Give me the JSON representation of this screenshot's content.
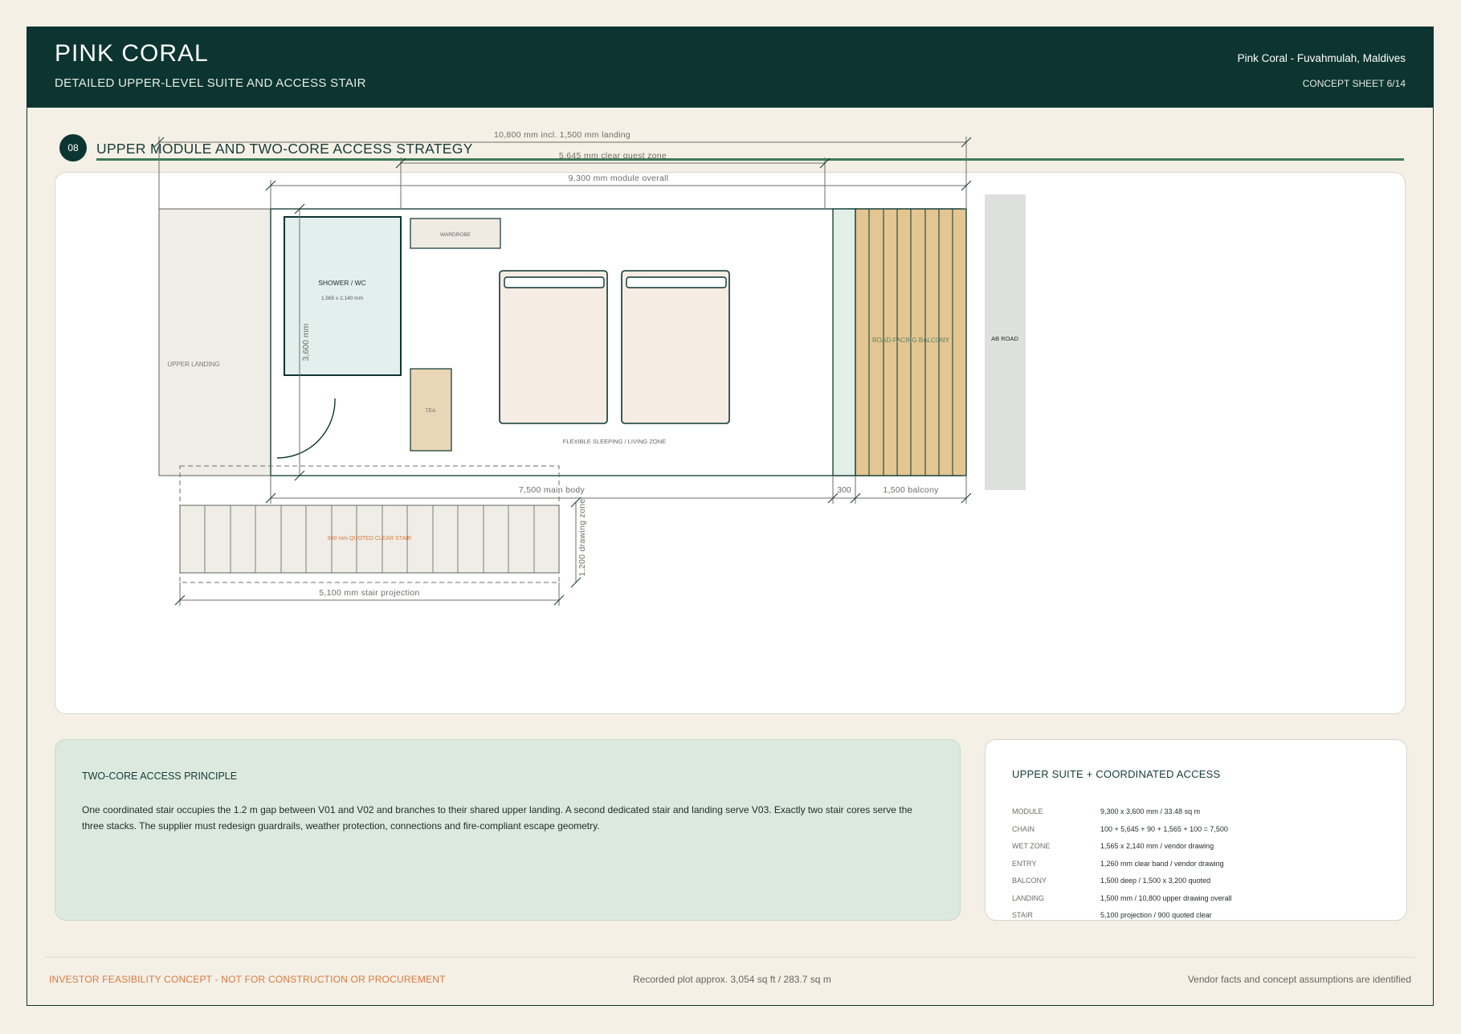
{
  "header": {
    "brand": "PINK CORAL",
    "subtitle": "DETAILED UPPER-LEVEL SUITE AND ACCESS STAIR",
    "location": "Pink Coral - Fuvahmulah, Maldives",
    "sheet": "CONCEPT SHEET 6/14"
  },
  "section": {
    "number": "08",
    "title": "UPPER MODULE AND TWO-CORE ACCESS STRATEGY"
  },
  "plan": {
    "dims": {
      "overall_with_landing": "10,800 mm incl. 1,500 mm landing",
      "clear_guest_zone": "5,645 mm clear guest zone",
      "module_overall": "9,300 mm module overall",
      "module_width": "3,600 mm",
      "main_body": "7,500 main body",
      "gap": "300",
      "balcony": "1,500 balcony",
      "drawing_zone": "1,200 drawing zone",
      "stair_projection": "5,100 mm stair projection"
    },
    "rooms": {
      "upper_landing": "UPPER LANDING",
      "shower_wc": "SHOWER / WC",
      "shower_size": "1,565 x 2,140 mm",
      "wardrobe": "WARDROBE",
      "tea": "TEA",
      "sleeping_zone": "FLEXIBLE SLEEPING / LIVING ZONE",
      "balcony": "ROAD-FACING BALCONY",
      "road": "AB ROAD",
      "stair": "900 mm QUOTED CLEAR STAIR"
    },
    "colors": {
      "ink": "#0c3531",
      "wet_zone": "#e2efec",
      "landing": "#efede6",
      "bed": "#f5ece3",
      "tea": "#e9d6b7",
      "balcony_deck": "#e3c691",
      "road": "#dde0dc",
      "accent_orange": "#d77a3e",
      "accent_green": "#3f7a55"
    }
  },
  "principle": {
    "title": "TWO-CORE ACCESS PRINCIPLE",
    "body": "One coordinated stair occupies the 1.2 m gap between V01 and V02 and branches to their shared upper landing. A second dedicated stair and landing serve V03. Exactly two stair cores serve the three stacks. The supplier must redesign guardrails, weather protection, connections and fire-compliant escape geometry."
  },
  "suite": {
    "title": "UPPER SUITE + COORDINATED ACCESS",
    "rows": [
      {
        "key": "MODULE",
        "value": "9,300 x 3,600 mm / 33.48 sq m"
      },
      {
        "key": "CHAIN",
        "value": "100 + 5,645 + 90 + 1,565 + 100 = 7,500"
      },
      {
        "key": "WET ZONE",
        "value": "1,565 x 2,140 mm / vendor drawing"
      },
      {
        "key": "ENTRY",
        "value": "1,260 mm clear band / vendor drawing"
      },
      {
        "key": "BALCONY",
        "value": "1,500 deep / 1,500 x 3,200 quoted"
      },
      {
        "key": "LANDING",
        "value": "1,500 mm / 10,800 upper drawing overall"
      },
      {
        "key": "STAIR",
        "value": "5,100 projection / 900 quoted clear"
      }
    ]
  },
  "footer": {
    "left": "INVESTOR FEASIBILITY CONCEPT - NOT FOR CONSTRUCTION OR PROCUREMENT",
    "center": "Recorded plot approx. 3,054 sq ft / 283.7 sq m",
    "right": "Vendor facts and concept assumptions are identified"
  }
}
